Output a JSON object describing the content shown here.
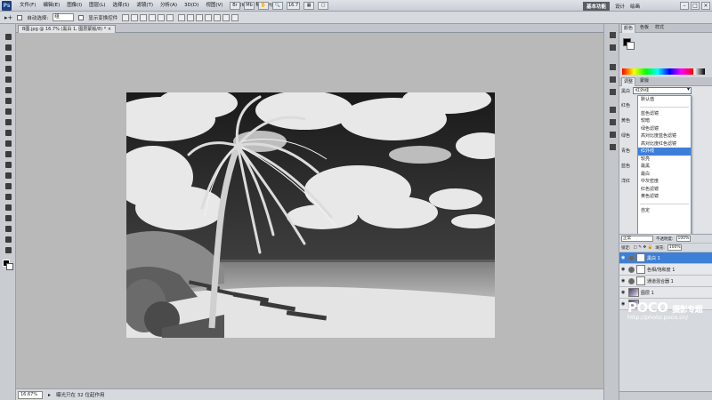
{
  "app": {
    "logo": "Ps"
  },
  "menubar": {
    "items": [
      "文件(F)",
      "编辑(E)",
      "图像(I)",
      "图层(L)",
      "选择(S)",
      "滤镜(T)",
      "分析(A)",
      "3D(D)",
      "视图(V)",
      "窗口(W)",
      "帮助(H)"
    ],
    "zoom": "16.7",
    "workspace_active": "基本功能",
    "workspace_items": [
      "设计",
      "绘画"
    ]
  },
  "options": {
    "auto_select_label": "自动选择:",
    "auto_select_value": "组",
    "show_transform_label": "显示变换控件"
  },
  "document": {
    "tab_title": "B图.jpg @ 16.7% (黑白 1, 图层蒙版/8) *",
    "zoom_percent": "16.67%",
    "status": "曝光只在 32 位起作用"
  },
  "color_panel": {
    "tabs": [
      "颜色",
      "色板",
      "样式"
    ]
  },
  "adjustments": {
    "tabs": [
      "调整",
      "蒙版"
    ],
    "preset_label": "黑白",
    "preset_value": "红外线",
    "side_labels": [
      "红色",
      "黄色",
      "绿色",
      "青色",
      "蓝色",
      "洋红"
    ],
    "dropdown": {
      "default": "默认值",
      "items": [
        "蓝色滤镜",
        "较暗",
        "绿色滤镜",
        "高对比度蓝色滤镜",
        "高对比度红色滤镜",
        "红外线",
        "较亮",
        "最黑",
        "最白",
        "中灰密度",
        "红色滤镜",
        "黄色滤镜"
      ],
      "selected_index": 5,
      "custom": "自定"
    }
  },
  "layers": {
    "blend_mode": "正常",
    "opacity_label": "不透明度:",
    "opacity": "100%",
    "lock_label": "锁定:",
    "fill_label": "填充:",
    "fill": "100%",
    "rows": [
      {
        "name": "黑白 1",
        "type": "adjustment",
        "active": true
      },
      {
        "name": "色相/饱和度 1",
        "type": "adjustment",
        "active": false
      },
      {
        "name": "通道混合器 1",
        "type": "adjustment",
        "active": false
      },
      {
        "name": "图层 1",
        "type": "image",
        "active": false
      },
      {
        "name": "",
        "type": "image",
        "active": false
      }
    ]
  },
  "watermark": {
    "brand": "POCO",
    "brand_sub": "摄影专题",
    "url": "http://photo.poco.cn/"
  }
}
